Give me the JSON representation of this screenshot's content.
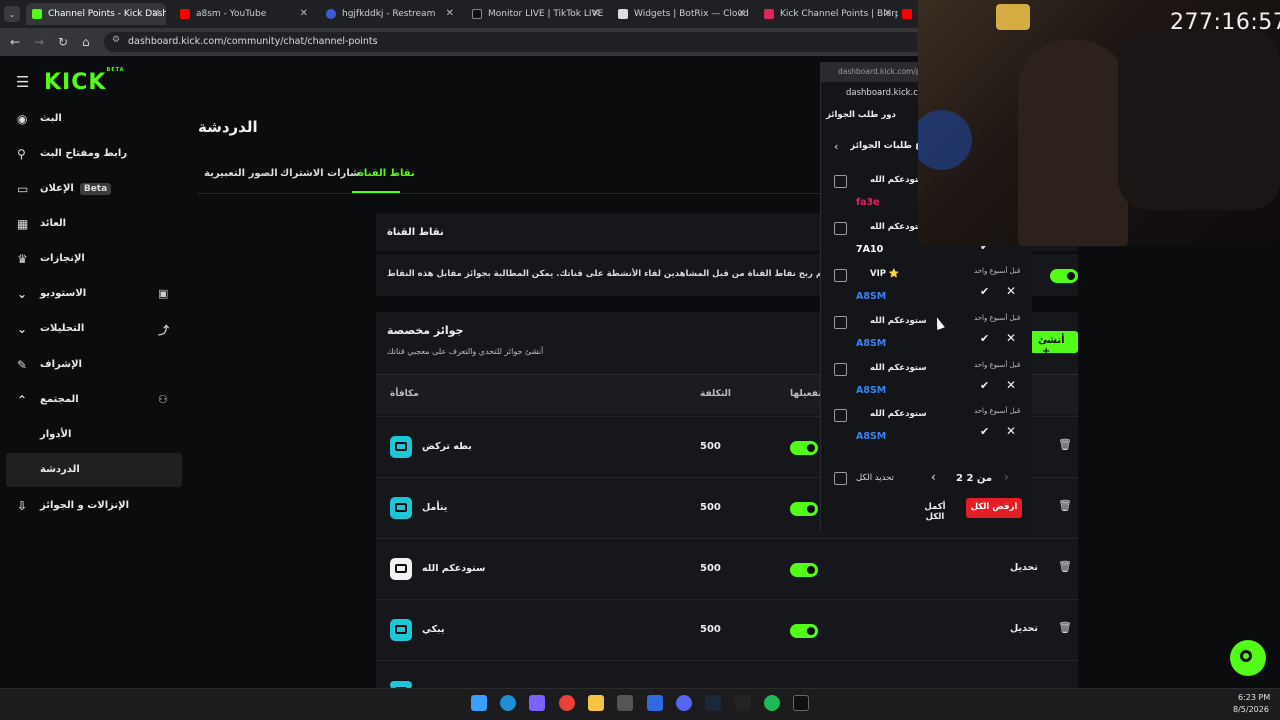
{
  "browser": {
    "tabs": [
      {
        "title": "Channel Points - Kick Dashb",
        "color": "#53fc18",
        "active": true
      },
      {
        "title": "a8sm - YouTube",
        "color": "#ff0000",
        "active": false
      },
      {
        "title": "hgjfkddkj - Restream",
        "color": "#3b5bdb",
        "active": false
      },
      {
        "title": "Monitor LIVE | TikTok LIVE C",
        "color": "#111111",
        "active": false
      },
      {
        "title": "Widgets | BotRix — Cloud S",
        "color": "#dddddd",
        "active": false
      },
      {
        "title": "Kick Channel Points | Blerp",
        "color": "#e0245e",
        "active": false
      }
    ],
    "url": "dashboard.kick.com/community/chat/channel-points"
  },
  "sidebar": {
    "logo": "KICK",
    "logo_badge": "BETA",
    "items": [
      {
        "label": "البث",
        "icon": "broadcast-icon"
      },
      {
        "label": "رابط ومفتاح البث",
        "icon": "link-icon"
      },
      {
        "label": "الإعلان",
        "icon": "ad-icon",
        "badge": "Beta"
      },
      {
        "label": "العائد",
        "icon": "revenue-icon"
      },
      {
        "label": "الإنجازات",
        "icon": "trophy-icon"
      },
      {
        "label": "الاستوديو",
        "icon": "studio-icon"
      },
      {
        "label": "التحليلات",
        "icon": "analytics-icon"
      },
      {
        "label": "الإشراف",
        "icon": "moderation-icon"
      },
      {
        "label": "المجتمع",
        "icon": "community-icon"
      },
      {
        "label": "الأدوار",
        "icon": ""
      },
      {
        "label": "الدردشة",
        "icon": ""
      },
      {
        "label": "الإنزالات و الجوائز",
        "icon": "drops-icon"
      }
    ]
  },
  "main": {
    "title": "الدردشة",
    "tabs": [
      "نقاط القناة",
      "شارات الاشتراك",
      "الصور التعبيرية"
    ],
    "channel_points": {
      "title": "نقاط القناة",
      "description": "اعرف المزيد .يتم ربح نقاط القناة من قبل المشاهدين لقاء الأنشطة على قناتك. يمكن المطالبة بجوائز مقابل هذه النقاط"
    },
    "custom_rewards": {
      "title": "جوائز مخصصة",
      "subtitle": "أنشئ جوائز للتحدي والتعرف على معجبي قناتك",
      "create_label": "أنشئ",
      "columns": [
        "مكافأة",
        "التكلفة",
        "تفعيلها"
      ],
      "rows": [
        {
          "name": "بطه تركض",
          "cost": "500",
          "icon": "cyan"
        },
        {
          "name": "يتأمل",
          "cost": "500",
          "icon": "cyan"
        },
        {
          "name": "ستودعكم الله",
          "cost": "500",
          "icon": "white"
        },
        {
          "name": "يبكي",
          "cost": "500",
          "icon": "cyan"
        }
      ],
      "edit_label": "تحديل"
    }
  },
  "popup": {
    "url_short": "dashboard.kick.com/pc",
    "url_short2": "dashboard.kick.co",
    "header": "دور طلب الجوائز",
    "subheader": "ع طلبات الجوائز",
    "requests": [
      {
        "reward": "ستودعكم الله",
        "user": "fa3e",
        "user_color": "#e0245e",
        "time": ""
      },
      {
        "reward": "ستودعكم الله",
        "user": "7A10",
        "user_color": "#ffffff",
        "time": ""
      },
      {
        "reward": "VIP ⭐",
        "user": "A8SM",
        "user_color": "#3b82f6",
        "time": "قبل أسبوع واحد"
      },
      {
        "reward": "ستودعكم الله",
        "user": "A8SM",
        "user_color": "#3b82f6",
        "time": "قبل أسبوع واحد"
      },
      {
        "reward": "ستودعكم الله",
        "user": "A8SM",
        "user_color": "#3b82f6",
        "time": "قبل أسبوع واحد"
      },
      {
        "reward": "ستودعكم الله",
        "user": "A8SM",
        "user_color": "#3b82f6",
        "time": "قبل أسبوع واحد"
      }
    ],
    "select_all": "تحديد الكل",
    "pagination": "2 من 2",
    "complete_all": "أكمل الكل",
    "reject_all": "ارفض الكل"
  },
  "overlay": {
    "timer": "277:16:57"
  },
  "taskbar": {
    "time": "6:23 PM",
    "date": "8/5/2026"
  },
  "colors": {
    "accent": "#53fc18",
    "danger": "#e31e24"
  }
}
